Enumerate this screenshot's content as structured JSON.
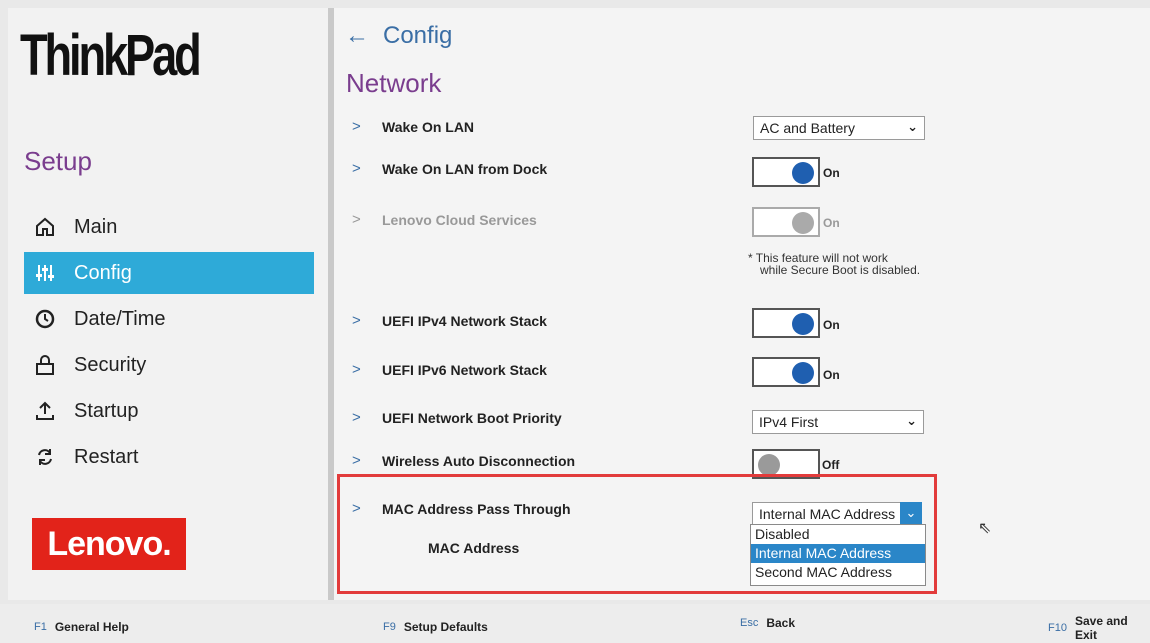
{
  "brand": "ThinkPad",
  "setup_title": "Setup",
  "nav": [
    {
      "label": "Main",
      "icon": "home-icon"
    },
    {
      "label": "Config",
      "icon": "sliders-icon",
      "active": true
    },
    {
      "label": "Date/Time",
      "icon": "clock-icon"
    },
    {
      "label": "Security",
      "icon": "lock-icon"
    },
    {
      "label": "Startup",
      "icon": "upload-icon"
    },
    {
      "label": "Restart",
      "icon": "refresh-icon"
    }
  ],
  "lenovo_logo": "Lenovo.",
  "breadcrumb": {
    "back_label": "Config"
  },
  "page_title": "Network",
  "settings": {
    "wake_on_lan": {
      "label": "Wake On LAN",
      "value": "AC and Battery"
    },
    "wake_on_lan_dock": {
      "label": "Wake On LAN from Dock",
      "value": "On"
    },
    "lenovo_cloud": {
      "label": "Lenovo Cloud Services",
      "value": "On",
      "note_line1": "* This feature will not work",
      "note_line2": "while Secure Boot is disabled."
    },
    "ipv4": {
      "label": "UEFI IPv4 Network Stack",
      "value": "On"
    },
    "ipv6": {
      "label": "UEFI IPv6 Network Stack",
      "value": "On"
    },
    "boot_priority": {
      "label": "UEFI Network Boot Priority",
      "value": "IPv4 First"
    },
    "wireless_auto": {
      "label": "Wireless Auto Disconnection",
      "value": "Off"
    },
    "mac_pass": {
      "label": "MAC Address Pass Through",
      "value": "Internal MAC Address",
      "options": [
        "Disabled",
        "Internal MAC Address",
        "Second MAC Address"
      ]
    },
    "mac_address": {
      "label": "MAC Address"
    }
  },
  "footer": [
    {
      "key": "F1",
      "label": "General Help"
    },
    {
      "key": "F9",
      "label": "Setup Defaults"
    },
    {
      "key": "Esc",
      "label": "Back"
    },
    {
      "key": "F10",
      "label": "Save and Exit"
    }
  ],
  "colors": {
    "accent": "#2eaad8",
    "purple": "#7a3d8e",
    "highlight": "#e23b3b",
    "brand_red": "#e2231a"
  }
}
